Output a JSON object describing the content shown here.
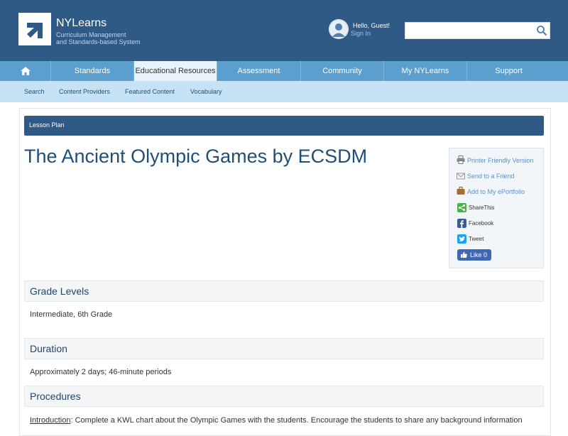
{
  "header": {
    "logo_name": "NYLearns",
    "tagline_line1": "Curriculum Management",
    "tagline_line2": "and Standards-based System",
    "greeting": "Hello, Guest!",
    "signin_label": "Sign In",
    "search_value": ""
  },
  "nav": {
    "items": [
      "Standards",
      "Educational Resources",
      "Assessment",
      "Community",
      "My NYLearns",
      "Support"
    ],
    "active": "Educational Resources"
  },
  "subnav": {
    "items": [
      "Search",
      "Content Providers",
      "Featured Content",
      "Vocabulary"
    ]
  },
  "lesson": {
    "bar_label": "Lesson Plan",
    "title": "The Ancient Olympic Games by ECSDM"
  },
  "sidebar": {
    "printer": "Printer Friendly Version",
    "send": "Send to a Friend",
    "portfolio": "Add to My ePortfolio",
    "sharethis": "ShareThis",
    "facebook": "Facebook",
    "tweet": "Tweet",
    "like": "Like 0"
  },
  "sections": {
    "grade_title": "Grade Levels",
    "grade_text": "Intermediate, 6th Grade",
    "duration_title": "Duration",
    "duration_text": "Approximately 2 days; 46-minute periods",
    "procedures_title": "Procedures",
    "intro_label": "Introduction",
    "intro_text": ": Complete a KWL chart about the Olympic Games with the students. Encourage the students to share any background information"
  },
  "colors": {
    "header_bg": "#2f5a85",
    "nav_bg": "#5b9fcf",
    "subnav_bg": "#c5e3f5",
    "title_color": "#1f4e79",
    "link_color": "#5d8fc4"
  }
}
